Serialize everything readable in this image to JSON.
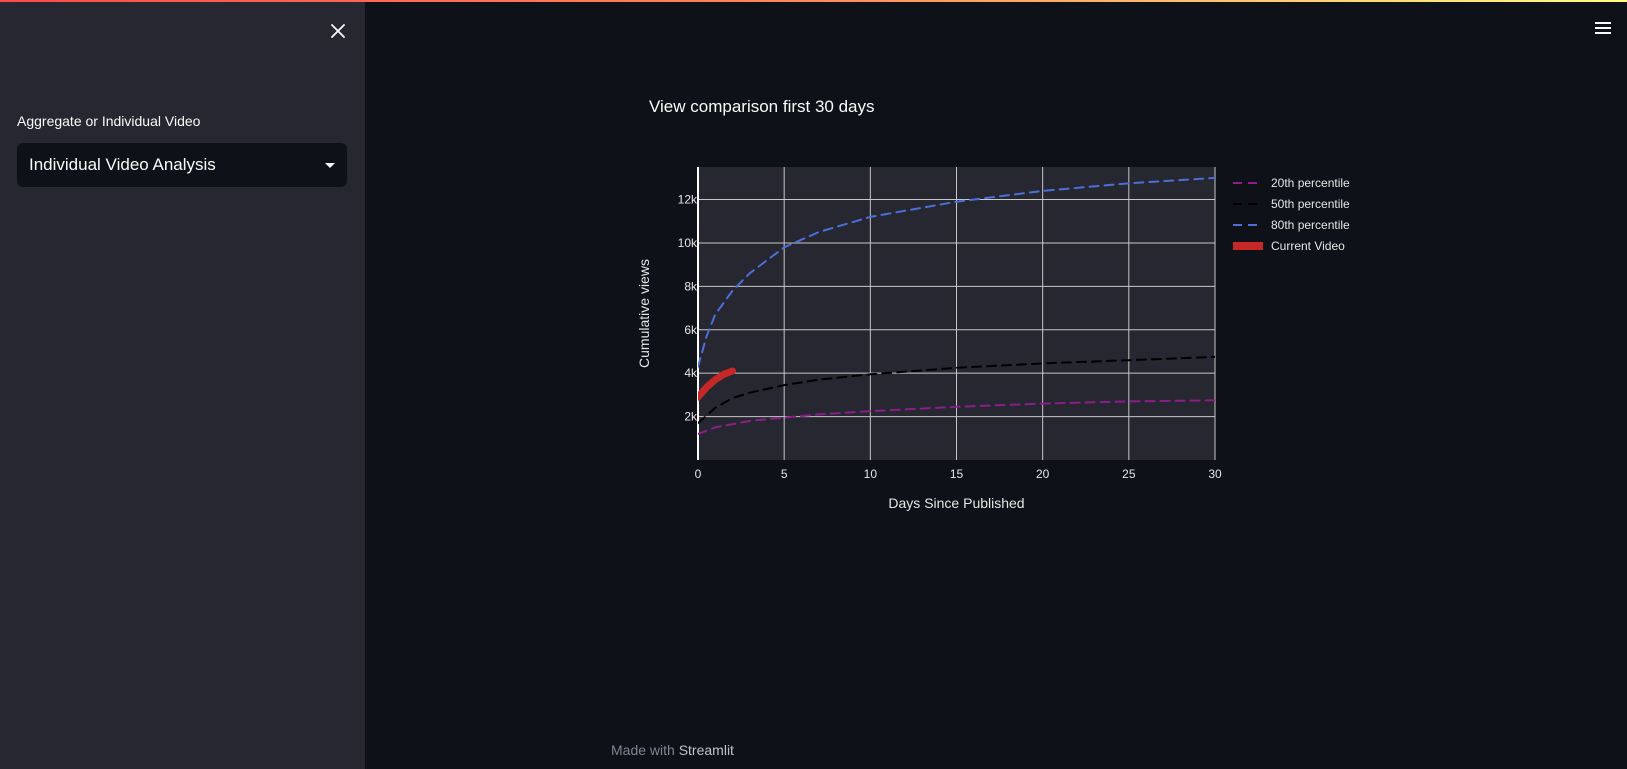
{
  "sidebar": {
    "label": "Aggregate or Individual Video",
    "select_value": "Individual Video Analysis"
  },
  "chart_title": "View comparison first 30 days",
  "footer": {
    "prefix": "Made with",
    "brand": "Streamlit"
  },
  "icons": {
    "close": "close-icon",
    "menu": "hamburger-menu-icon"
  },
  "colors": {
    "accent_gradient": [
      "#ff4b4b",
      "#fffd80"
    ],
    "background": "#0e1117",
    "sidebar": "#262730",
    "plot_bg": "#262730"
  },
  "chart_data": {
    "type": "line",
    "xlabel": "Days Since Published",
    "ylabel": "Cumulative views",
    "xlim": [
      0,
      30
    ],
    "ylim": [
      0,
      13500
    ],
    "x_ticks": [
      0,
      5,
      10,
      15,
      20,
      25,
      30
    ],
    "y_ticks": [
      2000,
      4000,
      6000,
      8000,
      10000,
      12000
    ],
    "y_tick_labels": [
      "2k",
      "4k",
      "6k",
      "8k",
      "10k",
      "12k"
    ],
    "grid": true,
    "legend_position": "right",
    "series": [
      {
        "name": "20th percentile",
        "color": "#8b1e8b",
        "dash": "dash",
        "x": [
          0,
          1,
          2,
          3,
          5,
          7,
          10,
          15,
          20,
          25,
          30
        ],
        "y": [
          1200,
          1500,
          1650,
          1800,
          1950,
          2100,
          2250,
          2450,
          2600,
          2700,
          2750
        ]
      },
      {
        "name": "50th percentile",
        "color": "#000000",
        "dash": "dash",
        "x": [
          0,
          1,
          2,
          3,
          5,
          7,
          10,
          15,
          20,
          25,
          30
        ],
        "y": [
          1700,
          2400,
          2850,
          3100,
          3450,
          3700,
          3950,
          4250,
          4450,
          4600,
          4750
        ]
      },
      {
        "name": "80th percentile",
        "color": "#4a6fd8",
        "dash": "dash",
        "x": [
          0,
          0.5,
          1,
          2,
          3,
          5,
          7,
          10,
          15,
          20,
          25,
          30
        ],
        "y": [
          4300,
          5700,
          6700,
          7800,
          8600,
          9800,
          10500,
          11200,
          11900,
          12400,
          12750,
          13000
        ]
      },
      {
        "name": "Current Video",
        "color": "#c62828",
        "dash": "solid",
        "x": [
          0,
          0.5,
          1,
          1.5,
          2
        ],
        "y": [
          2900,
          3350,
          3700,
          3950,
          4100
        ]
      }
    ]
  }
}
